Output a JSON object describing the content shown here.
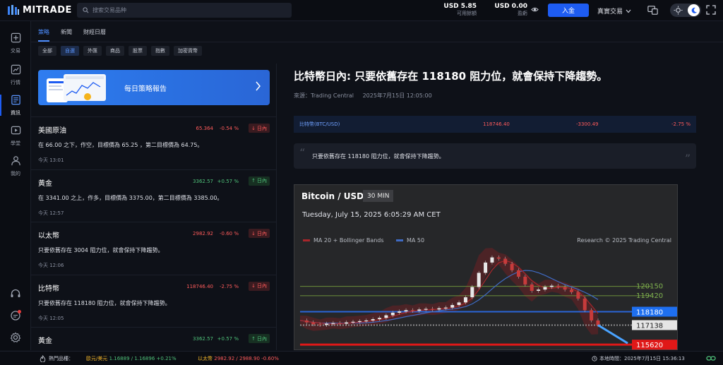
{
  "brand": "MITRADE",
  "search": {
    "placeholder": "搜索交易品种"
  },
  "account": {
    "available": {
      "value": "USD 5.85",
      "label": "可用餘額"
    },
    "profit": {
      "value": "USD 0.00",
      "label": "盈虧"
    },
    "deposit_label": "入金",
    "mode_label": "真實交易"
  },
  "leftnav": [
    {
      "label": "交易",
      "icon": "plus-square-icon"
    },
    {
      "label": "行情",
      "icon": "chart-line-icon"
    },
    {
      "label": "資訊",
      "icon": "news-icon"
    },
    {
      "label": "學堂",
      "icon": "play-icon"
    },
    {
      "label": "我的",
      "icon": "user-icon"
    }
  ],
  "tabs": [
    "策略",
    "新聞",
    "財經日曆"
  ],
  "filters": [
    "全部",
    "自選",
    "外匯",
    "商品",
    "股票",
    "指數",
    "加密貨幣"
  ],
  "banner": {
    "title": "每日策略報告"
  },
  "strategies": [
    {
      "name": "美國原油",
      "price": "65.364",
      "change": "-0.54 %",
      "dir": "down",
      "badge": "日內",
      "desc": "在 66.00 之下，作空，目標價為 65.25 ，第二目標價為 64.75。",
      "time": "今天 13:01"
    },
    {
      "name": "黃金",
      "price": "3362.57",
      "change": "+0.57 %",
      "dir": "up",
      "badge": "日內",
      "desc": "在 3341.00 之上，作多，目標價為 3375.00，第二目標價為 3385.00。",
      "time": "今天 12:57"
    },
    {
      "name": "以太幣",
      "price": "2982.92",
      "change": "-0.60 %",
      "dir": "down",
      "badge": "日內",
      "desc": "只要依舊存在 3004 阻力位，就會保持下降趨勢。",
      "time": "今天 12:06"
    },
    {
      "name": "比特幣",
      "price": "118746.40",
      "change": "-2.75 %",
      "dir": "down",
      "badge": "日內",
      "desc": "只要依舊存在 118180 阻力位，就會保持下降趨勢。",
      "time": "今天 12:05"
    },
    {
      "name": "黃金",
      "price": "3362.57",
      "change": "+0.57 %",
      "dir": "up",
      "badge": "日內",
      "desc": "",
      "time": ""
    }
  ],
  "article": {
    "headline": "比特幣日內: 只要依舊存在 118180 阻力位，就會保持下降趨勢。",
    "source": "來源：Trading Central",
    "datetime": "2025年7月15日 12:05:00",
    "quote_bar": {
      "symbol": "比特幣(BTC/USD)",
      "price": "118746.40",
      "change": "-3300.49",
      "percent": "-2.75 %"
    },
    "summary": "只要依舊存在 118180 阻力位，就會保持下降趨勢。"
  },
  "chart": {
    "title": "Bitcoin / USD",
    "timeframe": "30 MIN",
    "datetime": "Tuesday, July 15, 2025 6:05:29 AM CET",
    "legend": [
      {
        "name": "MA 20 + Bollinger Bands",
        "color": "#a8262b"
      },
      {
        "name": "MA 50",
        "color": "#3f6bc4"
      }
    ],
    "credit": "Research © 2025 Trading Central",
    "levels": [
      {
        "label": "120150",
        "kind": "text",
        "color": "#7fb24f"
      },
      {
        "label": "119420",
        "kind": "text",
        "color": "#7fb24f"
      },
      {
        "label": "118180",
        "kind": "tag",
        "color": "#1e6ff0"
      },
      {
        "label": "117138",
        "kind": "tag",
        "color": "#e5e5e5"
      },
      {
        "label": "115620",
        "kind": "tag",
        "color": "#e01818"
      }
    ]
  },
  "chart_data": {
    "type": "line",
    "title": "Bitcoin / USD",
    "series": [
      {
        "name": "MA 20 + Bollinger Bands",
        "color": "#a8262b"
      },
      {
        "name": "MA 50",
        "color": "#3f6bc4"
      }
    ],
    "price_levels": [
      120150,
      119420,
      118180,
      117138,
      115620
    ],
    "ylim": [
      115300,
      123200
    ],
    "price_path": [
      117500,
      117350,
      117200,
      117150,
      117250,
      117300,
      117250,
      117350,
      117400,
      117450,
      117500,
      117600,
      117700,
      117900,
      118100,
      118200,
      118300,
      118250,
      118350,
      118400,
      118350,
      118450,
      118500,
      118700,
      118900,
      119300,
      120100,
      121200,
      122000,
      122400,
      122300,
      121900,
      121400,
      120900,
      120300,
      119800,
      119900,
      120100,
      120200,
      120100,
      119900,
      119700,
      119200,
      118300,
      117500,
      117138
    ]
  },
  "bottombar": {
    "hot_label": "熱門品種：",
    "tickers": [
      {
        "name": "歐元/美元",
        "quote": "1.16889 / 1.16896",
        "change": "+0.21%",
        "dir": "up"
      },
      {
        "name": "以太幣",
        "quote": "2982.92 / 2988.90",
        "change": "-0.60%",
        "dir": "down"
      }
    ],
    "clock": "本地時間：2025年7月15日 15:36:13"
  }
}
